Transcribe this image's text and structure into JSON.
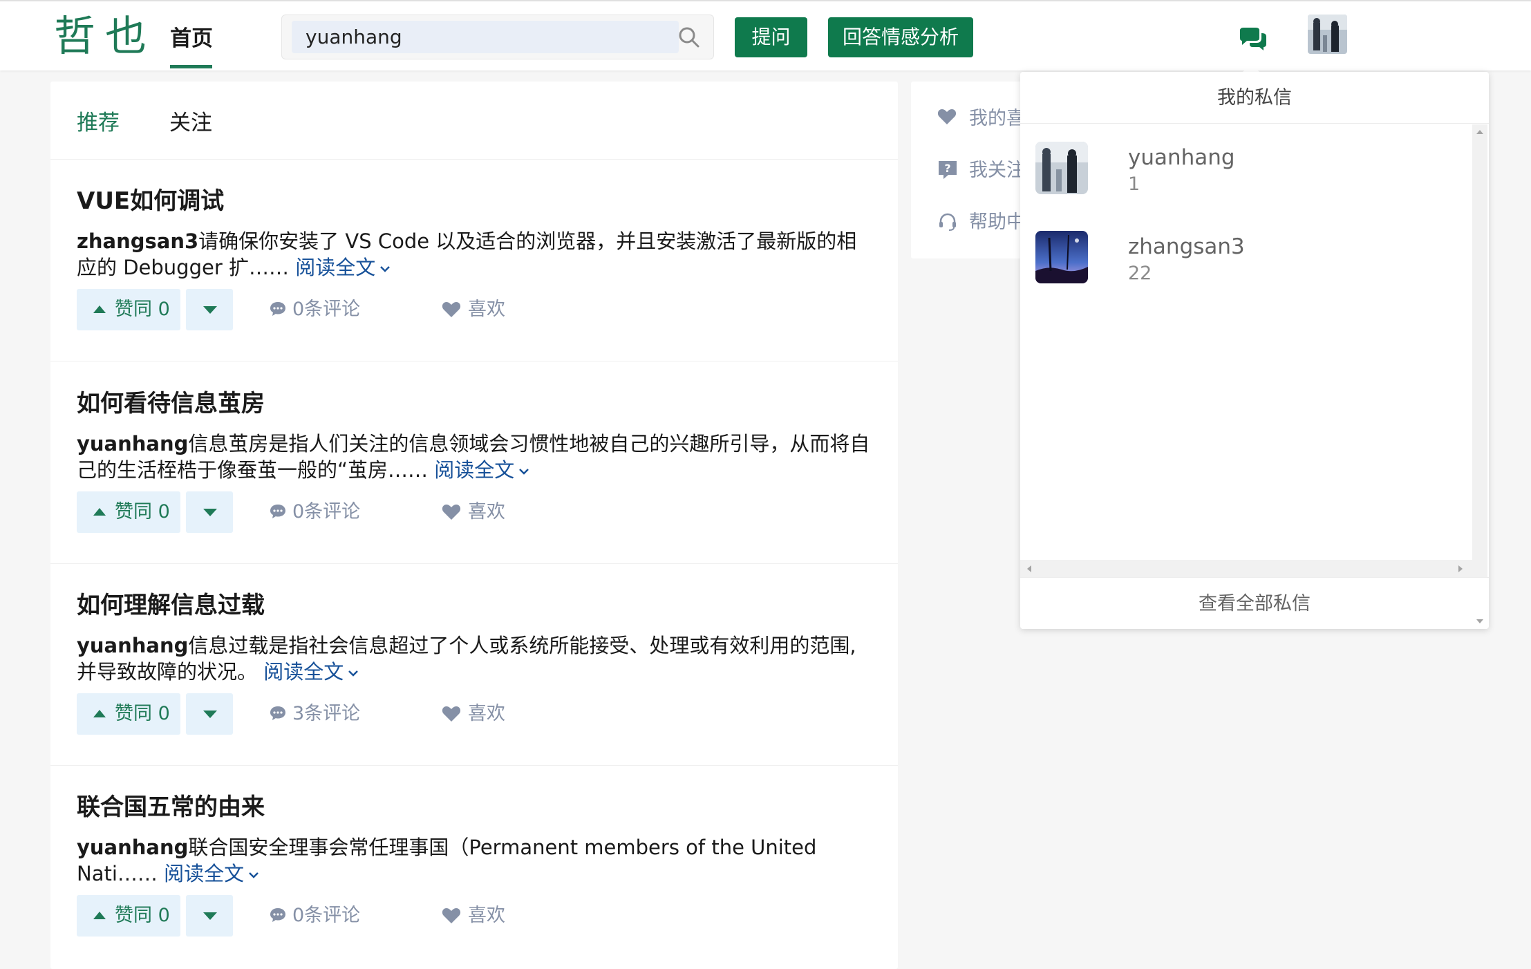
{
  "header": {
    "logo": "哲也",
    "nav_home": "首页",
    "search_value": "yuanhang",
    "ask_button": "提问",
    "analysis_button": "回答情感分析"
  },
  "tabs": {
    "recommend": "推荐",
    "follow": "关注"
  },
  "feed": [
    {
      "title": "VUE如何调试",
      "author": "zhangsan3",
      "excerpt": "请确保你安装了 VS Code 以及适合的浏览器，并且安装激活了最新版的相应的 Debugger 扩……",
      "read_more": "阅读全文",
      "upvote": "赞同 0",
      "comments": "0条评论",
      "like": "喜欢"
    },
    {
      "title": "如何看待信息茧房",
      "author": "yuanhang",
      "excerpt": "信息茧房是指人们关注的信息领域会习惯性地被自己的兴趣所引导，从而将自己的生活桎梏于像蚕茧一般的“茧房……",
      "read_more": "阅读全文",
      "upvote": "赞同 0",
      "comments": "0条评论",
      "like": "喜欢"
    },
    {
      "title": "如何理解信息过载",
      "author": "yuanhang",
      "excerpt": "信息过载是指社会信息超过了个人或系统所能接受、处理或有效利用的范围,并导致故障的状况。",
      "read_more": "阅读全文",
      "upvote": "赞同 0",
      "comments": "3条评论",
      "like": "喜欢"
    },
    {
      "title": "联合国五常的由来",
      "author": "yuanhang",
      "excerpt": "联合国安全理事会常任理事国（Permanent members of the United Nati……",
      "read_more": "阅读全文",
      "upvote": "赞同 0",
      "comments": "0条评论",
      "like": "喜欢"
    }
  ],
  "side": {
    "my_likes": "我的喜",
    "my_follows": "我关注",
    "help": "帮助中"
  },
  "messages": {
    "title": "我的私信",
    "items": [
      {
        "name": "yuanhang",
        "count": "1"
      },
      {
        "name": "zhangsan3",
        "count": "22"
      }
    ],
    "footer": "查看全部私信"
  },
  "colors": {
    "brand_green": "#1f7a57",
    "button_green": "#0f7a4d",
    "link_blue": "#175199",
    "muted": "#8590a6"
  }
}
